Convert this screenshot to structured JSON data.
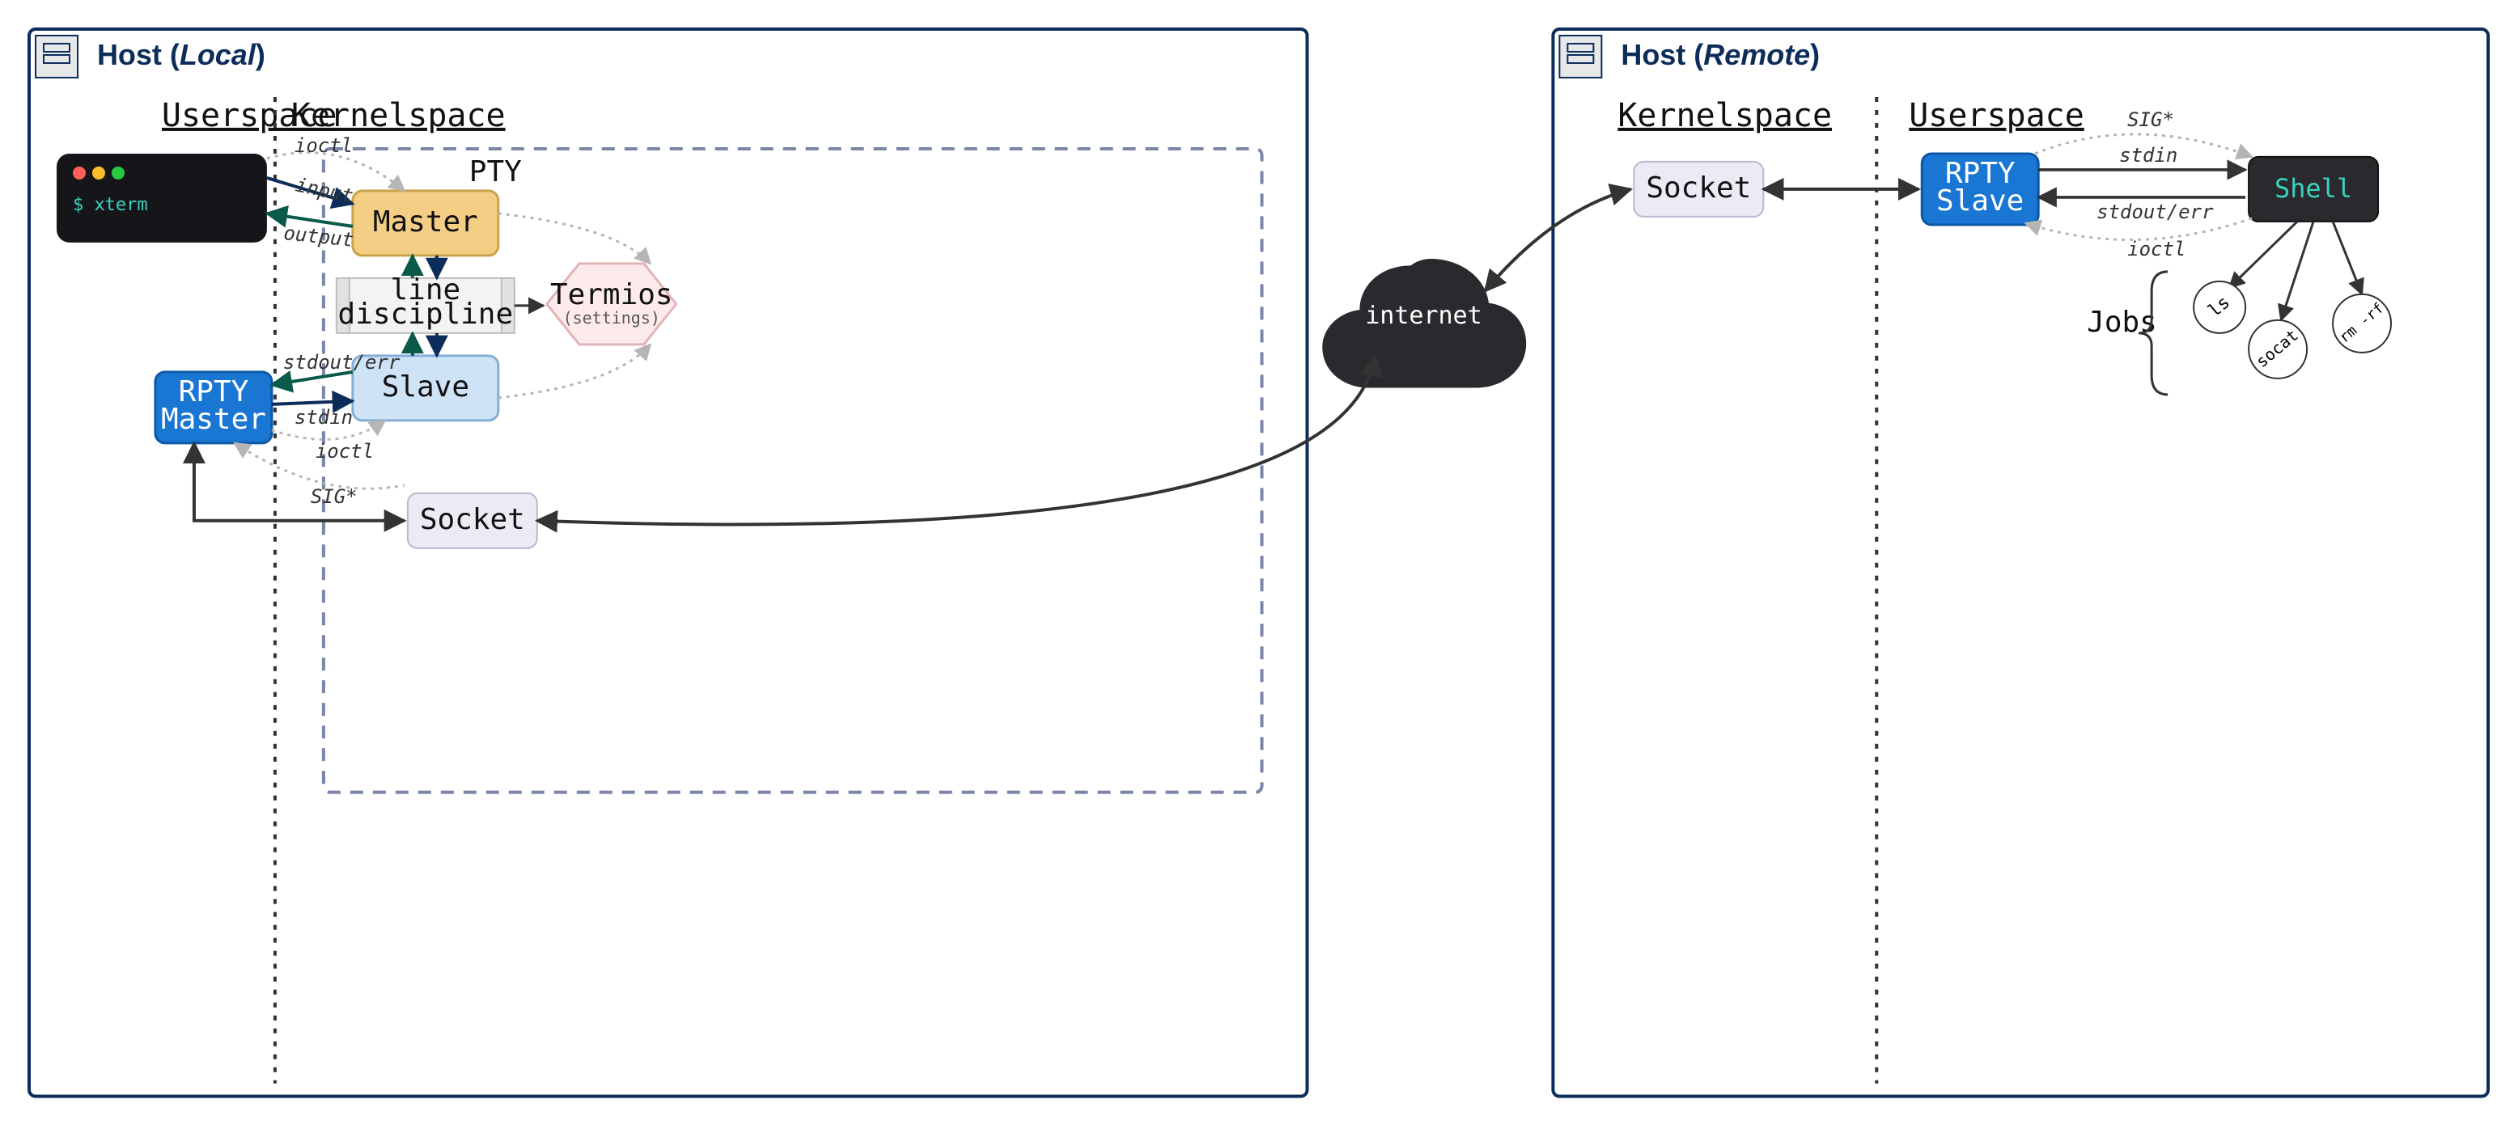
{
  "diagram": {
    "hosts": {
      "local": {
        "title_prefix": "Host (",
        "title_name": "Local",
        "title_suffix": ")"
      },
      "remote": {
        "title_prefix": "Host (",
        "title_name": "Remote",
        "title_suffix": ")"
      }
    },
    "sections": {
      "userspace": "Userspace",
      "kernelspace": "Kernelspace"
    },
    "nodes": {
      "xterm": {
        "prompt": "$ xterm"
      },
      "master": {
        "label": "Master"
      },
      "slave": {
        "label": "Slave"
      },
      "line_discipline": {
        "line1": "line",
        "line2": "discipline"
      },
      "termios": {
        "label": "Termios",
        "sub": "(settings)"
      },
      "rpty_master": {
        "line1": "RPTY",
        "line2": "Master"
      },
      "rpty_slave": {
        "line1": "RPTY",
        "line2": "Slave"
      },
      "socket_local": {
        "label": "Socket"
      },
      "socket_remote": {
        "label": "Socket"
      },
      "shell": {
        "label": "Shell"
      },
      "internet": {
        "label": "internet"
      },
      "pty_box": {
        "label": "PTY"
      },
      "jobs": {
        "label": "Jobs",
        "items": {
          "ls": "ls",
          "socat": "socat",
          "rm": "rm -rf"
        }
      }
    },
    "edges": {
      "input": "input",
      "output": "output",
      "ioctl_top": "ioctl",
      "stdout_err": "stdout/err",
      "stdin_l": "stdin",
      "ioctl_bot": "ioctl",
      "sig_l": "SIG*",
      "stdin_r": "stdin",
      "stdout_r": "stdout/err",
      "ioctl_r": "ioctl",
      "sig_r": "SIG*"
    },
    "colors": {
      "navy": "#0c2d5a",
      "blue": "#1976d2",
      "gold": "#f3ce84",
      "gold_b": "#caa24a",
      "sky": "#cfe3f7",
      "sky_b": "#85aed6",
      "pink": "#fdebec",
      "pink_b": "#e2b4b8",
      "gray": "#e8e8eb",
      "lav": "#ebebf5",
      "dark": "#2a2a2e",
      "black": "#16161a",
      "teal": "#0a5a4a",
      "dash": "#7a85a8",
      "dotted": "#b5b5b5"
    }
  }
}
